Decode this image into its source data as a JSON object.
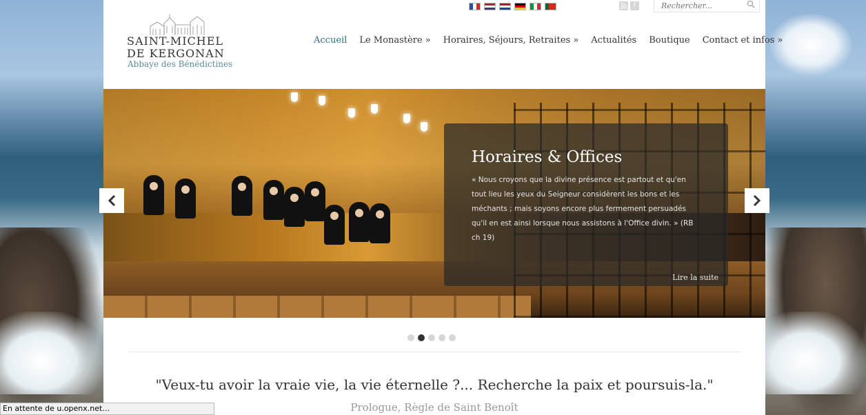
{
  "logo": {
    "line1": "SAINT-MICHEL",
    "line2": "DE KERGONAN",
    "line3": "Abbaye des Bénédictines"
  },
  "languages": [
    {
      "name": "fr-flag-icon",
      "colors": [
        "#2b4fa3",
        "#ffffff",
        "#d6262b"
      ],
      "dir": "v"
    },
    {
      "name": "us-flag-icon",
      "colors": [
        "#b22234",
        "#ffffff",
        "#3c3b6e"
      ],
      "dir": "h"
    },
    {
      "name": "nl-flag-icon",
      "colors": [
        "#ae1c28",
        "#ffffff",
        "#21468b"
      ],
      "dir": "h"
    },
    {
      "name": "de-flag-icon",
      "colors": [
        "#000000",
        "#dd0000",
        "#ffce00"
      ],
      "dir": "h"
    },
    {
      "name": "it-flag-icon",
      "colors": [
        "#009246",
        "#ffffff",
        "#ce2b37"
      ],
      "dir": "v"
    },
    {
      "name": "pt-flag-icon",
      "colors": [
        "#046a38",
        "#da291c",
        "#da291c"
      ],
      "dir": "v"
    }
  ],
  "search": {
    "placeholder": "Rechercher..."
  },
  "nav": [
    {
      "label": "Accueil",
      "active": true
    },
    {
      "label": "Le Monastère »",
      "active": false
    },
    {
      "label": "Horaires, Séjours, Retraites »",
      "active": false
    },
    {
      "label": "Actualités",
      "active": false
    },
    {
      "label": "Boutique",
      "active": false
    },
    {
      "label": "Contact et infos »",
      "active": false
    }
  ],
  "slider": {
    "title": "Horaires & Offices",
    "text": "« Nous croyons que la divine présence est partout et qu'en tout lieu les yeux du Seigneur considèrent les bons et les méchants ; mais soyons encore plus fermement persuadés qu'il en est ainsi lorsque nous assistons à l'Office divin. » (RB ch 19)",
    "more": "Lire la suite",
    "slide_count": 5,
    "active_index": 1
  },
  "quote": {
    "text": "\"Veux-tu avoir la vraie vie, la vie éternelle ?... Recherche la paix et poursuis-la.\"",
    "source": "Prologue, Règle de Saint Benoît"
  },
  "status_bar": "En attente de u.openx.net...",
  "colors": {
    "accent": "#2a6b78",
    "logo_sub": "#5a8a9b"
  }
}
